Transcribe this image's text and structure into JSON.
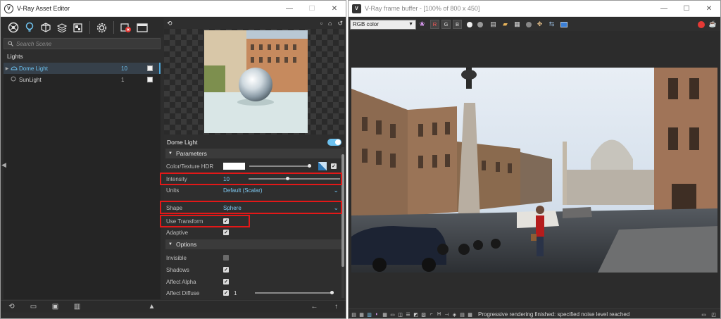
{
  "asset_editor": {
    "title": "V-Ray Asset Editor",
    "window_controls": [
      "—",
      "☐",
      "✕"
    ],
    "toolbar_icons": [
      "materials-icon",
      "lights-icon",
      "geometry-icon",
      "textures-icon",
      "render-elements-icon",
      "settings-icon",
      "render-icon",
      "framebuffer-icon"
    ],
    "search_placeholder": "Search Scene",
    "category": "Lights",
    "assets": [
      {
        "name": "Dome Light",
        "value": "10",
        "selected": true
      },
      {
        "name": "SunLight",
        "value": "1",
        "selected": false
      }
    ],
    "preview": {
      "toolbar_icons": [
        "render-preview-icon",
        "square-icon",
        "scene-icon",
        "reset-icon"
      ]
    },
    "asset_title": "Dome Light",
    "parameters": {
      "section": "Parameters",
      "color_texture_label": "Color/Texture HDR",
      "intensity_label": "Intensity",
      "intensity_value": "10",
      "intensity_level": 0.41,
      "units_label": "Units",
      "units_value": "Default (Scalar)",
      "shape_label": "Shape",
      "shape_value": "Sphere",
      "use_transform_label": "Use Transform",
      "adaptive_label": "Adaptive"
    },
    "options": {
      "section": "Options",
      "invisible_label": "Invisible",
      "shadows_label": "Shadows",
      "affect_alpha_label": "Affect Alpha",
      "affect_diffuse_label": "Affect Diffuse",
      "affect_diffuse_value": "1"
    },
    "bottom_icons": [
      "new-asset-icon",
      "open-icon",
      "save-icon",
      "delete-icon",
      "purge-icon",
      "back-arrow-icon",
      "up-arrow-icon"
    ]
  },
  "frame_buffer": {
    "title": "V-Ray frame buffer - [100% of 800 x 450]",
    "window_controls": [
      "—",
      "☐",
      "✕"
    ],
    "channel_select": "RGB color",
    "channel_buttons": [
      "R",
      "G",
      "B"
    ],
    "status_text": "Progressive rendering finished: specified noise level reached"
  },
  "colors": {
    "accent": "#6cc1ef",
    "highlight": "#e31818",
    "panel": "#2d2d2d",
    "stop": "#e53935"
  }
}
